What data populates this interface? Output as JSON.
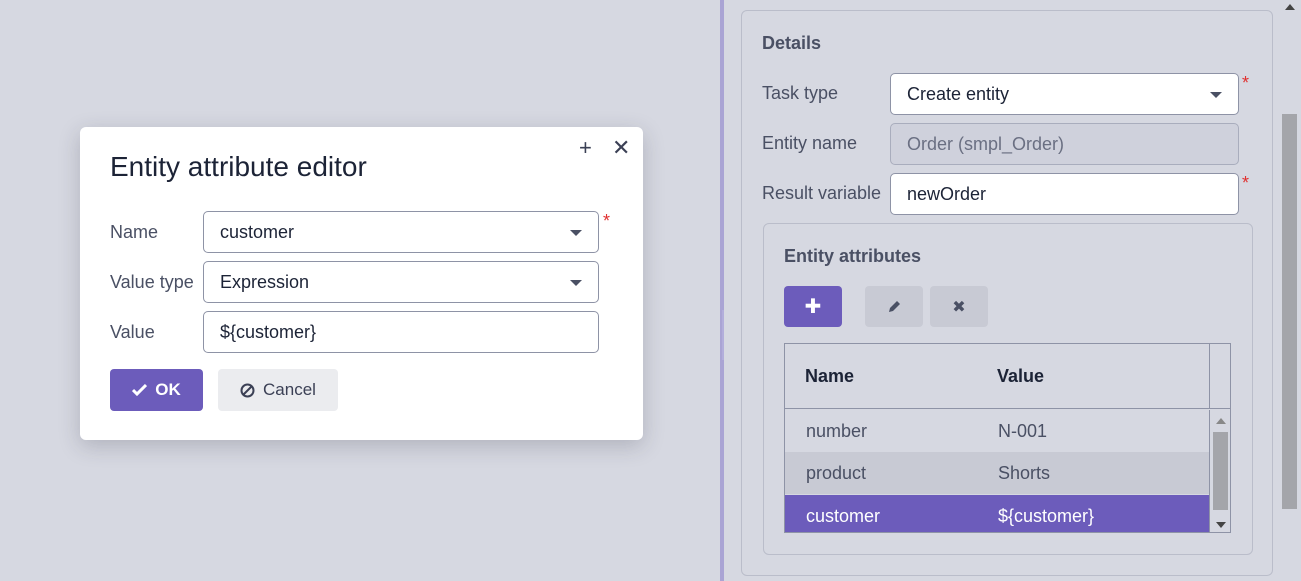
{
  "dialog": {
    "title": "Entity attribute editor",
    "fields": {
      "name_label": "Name",
      "name_value": "customer",
      "value_type_label": "Value type",
      "value_type_value": "Expression",
      "value_label": "Value",
      "value_value": "${customer}"
    },
    "ok_label": "OK",
    "cancel_label": "Cancel"
  },
  "details": {
    "title": "Details",
    "task_type_label": "Task type",
    "task_type_value": "Create entity",
    "entity_name_label": "Entity name",
    "entity_name_value": "Order (smpl_Order)",
    "result_variable_label": "Result variable",
    "result_variable_value": "newOrder",
    "required_mark": "*"
  },
  "attributes": {
    "title": "Entity attributes",
    "columns": [
      "Name",
      "Value"
    ],
    "rows": [
      {
        "name": "number",
        "value": "N-001"
      },
      {
        "name": "product",
        "value": "Shorts"
      },
      {
        "name": "customer",
        "value": "${customer}"
      }
    ]
  },
  "colors": {
    "accent": "#6c5cbb",
    "background": "#d6d8e1",
    "required": "#e0302f"
  }
}
